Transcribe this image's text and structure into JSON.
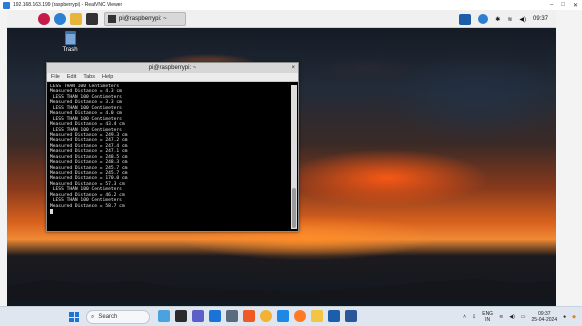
{
  "viewer": {
    "title": "192.168.163.199 (raspberrypi) - RealVNC Viewer",
    "minimize": "–",
    "maximize": "□",
    "close": "✕"
  },
  "rpi_panel": {
    "taskbar_terminal_label": "pi@raspberrypi: ~",
    "clock": "09:37",
    "icons": [
      "raspberry-menu-icon",
      "browser-icon",
      "folder-icon",
      "terminal-icon",
      "vnc-icon",
      "bluetooth-icon",
      "wifi-icon",
      "volume-icon"
    ]
  },
  "desktop": {
    "trash_label": "Trash"
  },
  "terminal": {
    "title": "pi@raspberrypi: ~",
    "close": "×",
    "menu": [
      "File",
      "Edit",
      "Tabs",
      "Help"
    ],
    "lines": [
      "LESS THAN 100 Centimeters",
      "Measured Distance = 4.3 cm",
      " LESS THAN 100 Centimeters",
      "Measured Distance = 3.3 cm",
      " LESS THAN 100 Centimeters",
      "Measured Distance = 4.0 cm",
      " LESS THAN 100 Centimeters",
      "Measured Distance = 43.4 cm",
      " LESS THAN 100 Centimeters",
      "Measured Distance = 249.3 cm",
      "Measured Distance = 247.2 cm",
      "Measured Distance = 247.4 cm",
      "Measured Distance = 247.1 cm",
      "Measured Distance = 248.5 cm",
      "Measured Distance = 248.3 cm",
      "Measured Distance = 245.7 cm",
      "Measured Distance = 245.7 cm",
      "Measured Distance = 170.0 cm",
      "Measured Distance = 57.3 cm",
      " LESS THAN 100 Centimeters",
      "Measured Distance = 46.2 cm",
      " LESS THAN 100 Centimeters",
      "Measured Distance = 58.7 cm"
    ]
  },
  "windows_taskbar": {
    "search_placeholder": "Search",
    "language_top": "ENG",
    "language_bottom": "IN",
    "time": "09:37",
    "date": "25-04-2024",
    "apps": [
      "widgets-icon",
      "task-view-icon",
      "teams-icon",
      "snipping-icon",
      "settings-icon",
      "brave-icon",
      "chrome-icon",
      "vscode-icon",
      "firefox-icon",
      "explorer-icon",
      "vnc-viewer-icon",
      "word-icon"
    ]
  }
}
